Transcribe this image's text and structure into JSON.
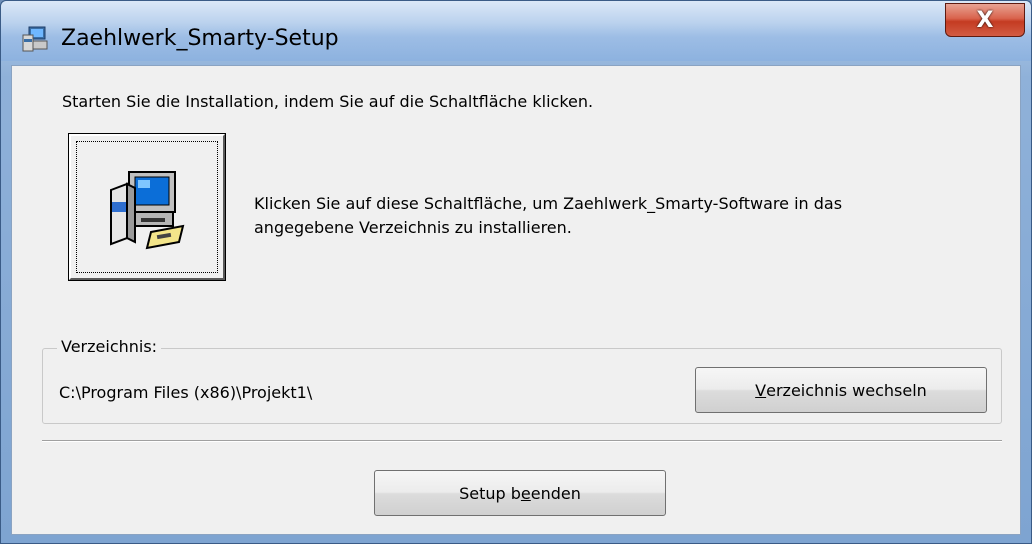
{
  "window": {
    "title": "Zaehlwerk_Smarty-Setup",
    "close_label": "X"
  },
  "intro_text": "Starten Sie die Installation, indem Sie auf die Schaltfläche klicken.",
  "install": {
    "icon": "installer-computer-icon",
    "description_line1": "Klicken Sie auf diese Schaltfläche, um Zaehlwerk_Smarty-Software in das",
    "description_line2": "angegebene Verzeichnis zu installieren."
  },
  "directory": {
    "group_label": "Verzeichnis:",
    "path": "C:\\Program Files (x86)\\Projekt1\\",
    "change_button": {
      "mnemonic": "V",
      "rest": "erzeichnis wechseln"
    }
  },
  "exit_button": {
    "before": "Setup b",
    "mnemonic": "e",
    "after": "enden"
  },
  "colors": {
    "close_button": "#c43b22",
    "client_bg": "#f0f0f0"
  }
}
